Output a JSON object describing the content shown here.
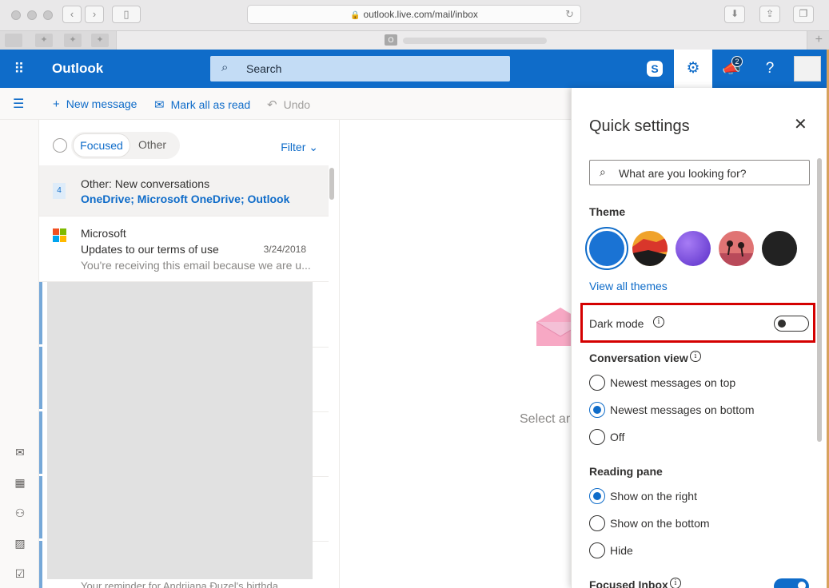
{
  "browser": {
    "url": "outlook.live.com/mail/inbox",
    "back": "‹",
    "forward": "›",
    "new_tab": "+"
  },
  "header": {
    "brand": "Outlook",
    "search_label": "Search",
    "notifications_count": "2",
    "help": "?"
  },
  "commands": {
    "new_message": "New message",
    "mark_all_read": "Mark all as read",
    "undo": "Undo"
  },
  "mail_list": {
    "tab_focused": "Focused",
    "tab_other": "Other",
    "filter": "Filter",
    "grouped": {
      "count": "4",
      "title": "Other: New conversations",
      "senders": "OneDrive; Microsoft OneDrive; Outlook"
    },
    "message": {
      "sender": "Microsoft",
      "subject": "Updates to our terms of use",
      "date": "3/24/2018",
      "preview": "You're receiving this email because we are u..."
    },
    "bottom_preview": "Your reminder for Andrijana Đuzel's birthda..."
  },
  "reading_pane": {
    "empty_text": "Select ar"
  },
  "quick_settings": {
    "title": "Quick settings",
    "search_placeholder": "What are you looking for?",
    "theme_heading": "Theme",
    "themes": [
      {
        "name": "blue",
        "color": "#1a73d4",
        "selected": true
      },
      {
        "name": "sunset",
        "color": "#d9472b",
        "selected": false
      },
      {
        "name": "purple",
        "color": "#7c4de0",
        "selected": false
      },
      {
        "name": "palms",
        "color": "#d96b6b",
        "selected": false
      },
      {
        "name": "black",
        "color": "#222222",
        "selected": false
      }
    ],
    "view_all_themes": "View all themes",
    "dark_mode": "Dark mode",
    "dark_mode_on": false,
    "conversation_view": {
      "heading": "Conversation view",
      "options": [
        "Newest messages on top",
        "Newest messages on bottom",
        "Off"
      ],
      "selected": "Newest messages on bottom"
    },
    "reading_pane": {
      "heading": "Reading pane",
      "options": [
        "Show on the right",
        "Show on the bottom",
        "Hide"
      ],
      "selected": "Show on the right"
    },
    "focused_inbox": "Focused Inbox",
    "focused_inbox_on": true
  },
  "colors": {
    "brand_blue": "#0f6cc9",
    "highlight_red": "#d40000"
  }
}
